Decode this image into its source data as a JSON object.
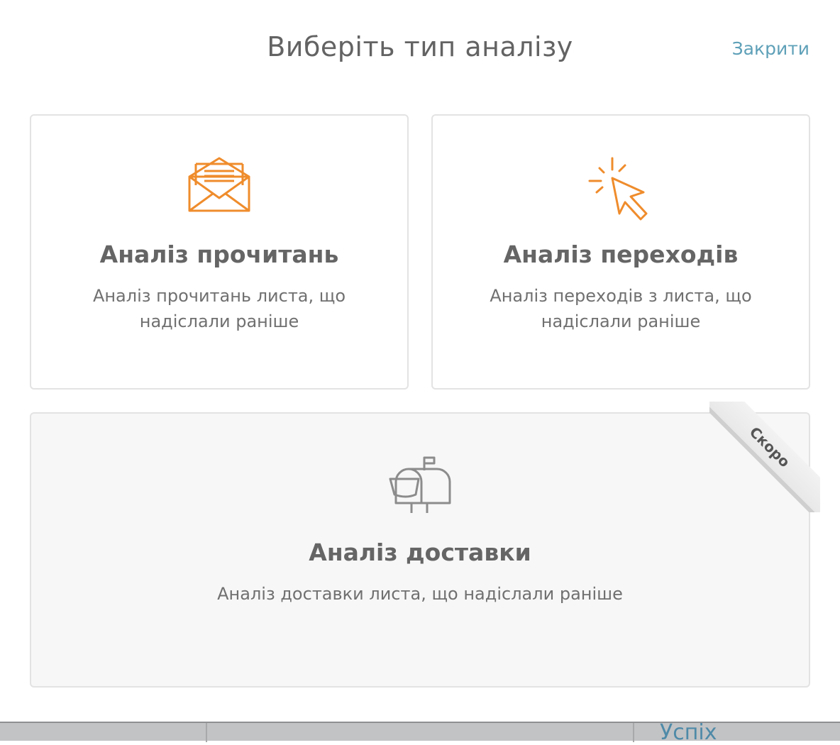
{
  "modal": {
    "title": "Виберіть тип аналізу",
    "close_label": "Закрити"
  },
  "cards": [
    {
      "title": "Аналіз прочитань",
      "description": "Аналіз прочитань листа, що надіслали раніше",
      "icon": "envelope-open-icon"
    },
    {
      "title": "Аналіз переходів",
      "description": "Аналіз переходів з листа, що надіслали раніше",
      "icon": "cursor-click-icon"
    },
    {
      "title": "Аналіз доставки",
      "description": "Аналіз доставки листа, що надіслали раніше",
      "icon": "mailbox-icon",
      "badge": "Скоро"
    }
  ],
  "colors": {
    "accent": "#ef8c2c",
    "link": "#5ea0b8",
    "disabled_icon": "#8c8c8c"
  },
  "background_page": {
    "partial_text": "Успіх"
  }
}
